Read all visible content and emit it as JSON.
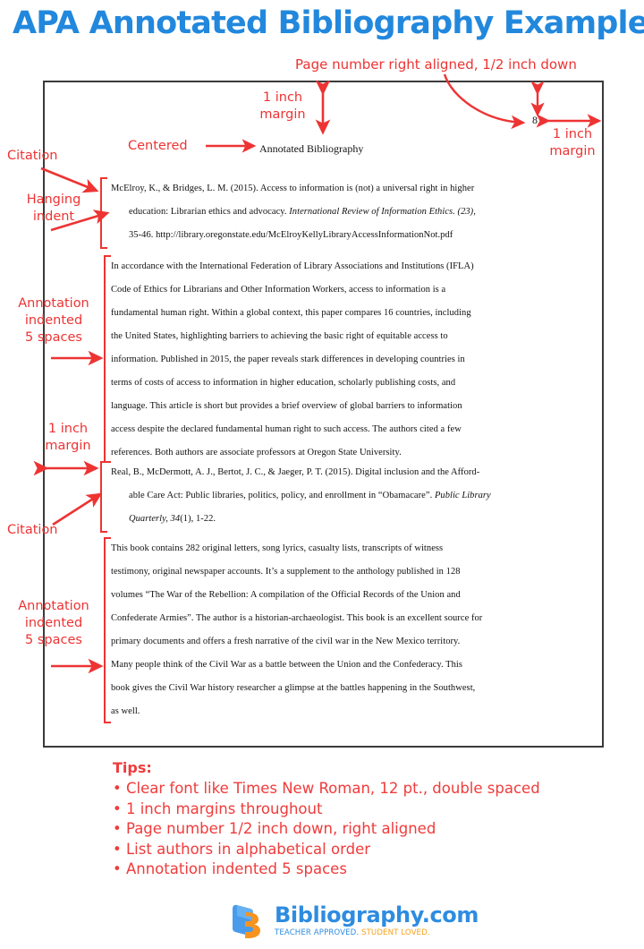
{
  "title": "APA Annotated Bibliography Example",
  "colors": {
    "title_blue": "#2288dd",
    "annotation_red": "#ee3333",
    "tips_red": "#f03b3b",
    "logo_blue": "#2e8ce0",
    "logo_orange": "#f7a11a",
    "sheet_border": "#3a3a3a"
  },
  "document": {
    "heading": "Annotated Bibliography",
    "page_number": "8",
    "entries": [
      {
        "citation_lines": [
          "McElroy, K., & Bridges, L. M. (2015). Access to information is (not) a universal right in higher",
          "education: Librarian ethics and advocacy. International Review of Information Ethics. (23),",
          "35-46. http://library.oregonstate.edu/McElroyKellyLibraryAccessInformationNot.pdf"
        ],
        "annotation_lines": [
          "In accordance with the International Federation of Library Associations and Institutions (IFLA)",
          "Code of Ethics for Librarians and Other Information Workers, access to information is a",
          "fundamental human right.  Within a global context, this paper compares 16 countries, including",
          "the United States, highlighting barriers to achieving the basic right of equitable access to",
          "information. Published in 2015, the paper reveals stark differences in developing countries in",
          "terms of costs of access to information in higher education, scholarly publishing costs, and",
          "language. This article is short but provides a brief overview of global barriers to information",
          "access despite the declared fundamental human right to such access. The authors cited a few",
          "references. Both authors are associate professors at Oregon State University."
        ]
      },
      {
        "citation_lines": [
          "Real, B., McDermott, A. J., Bertot, J. C., & Jaeger, P. T. (2015). Digital inclusion and the Afford-",
          "able Care Act: Public libraries, politics, policy, and enrollment in “Obamacare”. Public Library",
          "Quarterly, 34(1), 1-22."
        ],
        "annotation_lines": [
          "This book contains 282 original letters, song lyrics, casualty lists, transcripts of witness",
          "testimony, original newspaper accounts. It’s a supplement to the anthology published in 128",
          "volumes “The War of the Rebellion: A compilation of the Official Records of the Union and",
          "Confederate Armies”. The author is a historian-archaeologist. This book is an excellent source for",
          "primary documents and offers a fresh narrative of the civil war in the New Mexico territory.",
          "Many people think of the Civil War as a battle between the Union and the Confederacy. This",
          "book gives the Civil War history researcher a glimpse at the battles happening in the Southwest,",
          "as well."
        ]
      }
    ]
  },
  "callouts": {
    "page_number_note": "Page number right aligned, 1/2 inch down",
    "top_margin": "1 inch\nmargin",
    "centered": "Centered",
    "right_margin": "1 inch\nmargin",
    "citation_1": "Citation",
    "hanging_indent": "Hanging\nindent",
    "annotation_indent_1": "Annotation\nindented\n5 spaces",
    "left_margin": "1 inch\nmargin",
    "citation_2": "Citation",
    "annotation_indent_2": "Annotation\nindented\n5 spaces"
  },
  "tips": {
    "title": "Tips:",
    "items": [
      "Clear font like Times New Roman, 12 pt., double spaced",
      "1 inch margins throughout",
      "Page number 1/2 inch down, right aligned",
      "List authors in alphabetical order",
      "Annotation indented 5 spaces"
    ]
  },
  "logo": {
    "name": "Bibliography.com",
    "tagline_blue": "TEACHER APPROVED.",
    "tagline_orange": "STUDENT LOVED."
  }
}
